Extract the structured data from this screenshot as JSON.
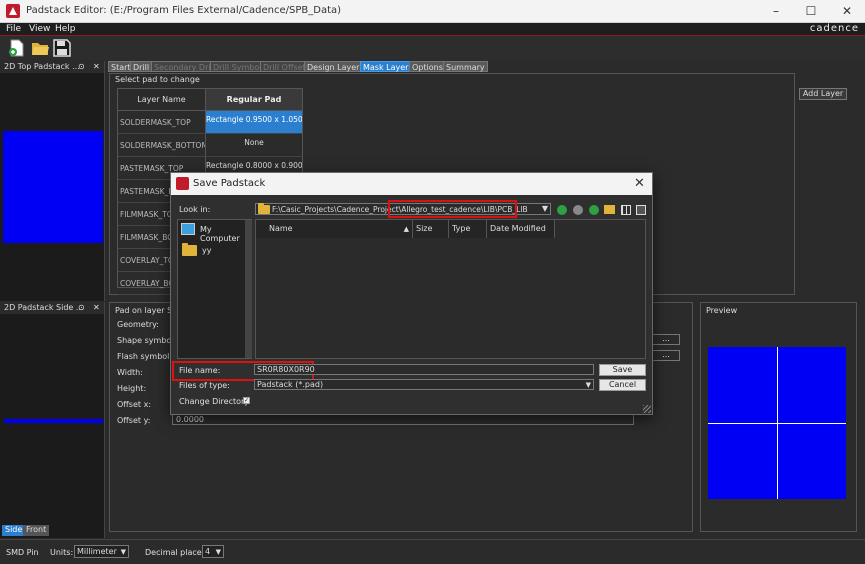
{
  "app": {
    "title": "Padstack Editor:  (E:/Program Files External/Cadence/SPB_Data)",
    "brand": "cadence",
    "menu": [
      "File",
      "View",
      "Help"
    ],
    "colors": {
      "accent": "#2a7fd0",
      "highlight_red": "#d11111",
      "pad_blue": "#0000f5"
    }
  },
  "left_panes": {
    "top_title": "2D Top Padstack ...",
    "side_title": "2D Padstack Side ...",
    "side_tabs": [
      "Side",
      "Front"
    ],
    "pin": "⊙",
    "close": "✕"
  },
  "tabs": [
    "Start",
    "Drill",
    "Secondary Drill",
    "Drill Symbol",
    "Drill Offset",
    "Design Layers",
    "Mask Layers",
    "Options",
    "Summary"
  ],
  "tabs_state": {
    "active": "Mask Layers",
    "disabled": [
      "Secondary Drill",
      "Drill Symbol",
      "Drill Offset"
    ]
  },
  "mask_layers": {
    "section_label": "Select pad to change",
    "col_layer": "Layer Name",
    "col_regular": "Regular Pad",
    "rows": [
      {
        "layer": "SOLDERMASK_TOP",
        "pad": "Rectangle 0.9500 x 1.0500"
      },
      {
        "layer": "SOLDERMASK_BOTTOM",
        "pad": "None"
      },
      {
        "layer": "PASTEMASK_TOP",
        "pad": "Rectangle 0.8000 x 0.9000"
      },
      {
        "layer": "PASTEMASK_B",
        "pad": ""
      },
      {
        "layer": "FILMMASK_TO",
        "pad": ""
      },
      {
        "layer": "FILMMASK_BO",
        "pad": ""
      },
      {
        "layer": "COVERLAY_TO",
        "pad": ""
      },
      {
        "layer": "COVERLAY_BO",
        "pad": ""
      }
    ],
    "add_layer": "Add Layer"
  },
  "pad_on_layer": {
    "title": "Pad on layer SO",
    "labels": [
      "Geometry:",
      "Shape symbol:",
      "Flash symbol:",
      "Width:",
      "Height:",
      "Offset x:",
      "Offset y:"
    ],
    "offset_y_value": "0.0000",
    "browse": "..."
  },
  "preview": {
    "title": "Preview"
  },
  "status": {
    "pin_type": "SMD Pin",
    "units_label": "Units:",
    "units_value": "Millimeter",
    "decimal_label": "Decimal places:",
    "decimal_value": "4"
  },
  "dialog": {
    "title": "Save Padstack",
    "look_in_label": "Look in:",
    "look_in_value": "F:\\Casic_Projects\\Cadence_Project\\Allegro_test_cadence\\LIB\\PCB_LIB",
    "sidebar": [
      {
        "label": "My Computer",
        "icon": "computer-icon"
      },
      {
        "label": "yy",
        "icon": "folder-icon"
      }
    ],
    "columns": [
      "Name",
      "Size",
      "Type",
      "Date Modified"
    ],
    "file_name_label": "File name:",
    "file_name_value": "SR0R80X0R90",
    "files_of_type_label": "Files of type:",
    "files_of_type_value": "Padstack (*.pad)",
    "save": "Save",
    "cancel": "Cancel",
    "change_directory": "Change Directory",
    "change_directory_checked": true
  }
}
